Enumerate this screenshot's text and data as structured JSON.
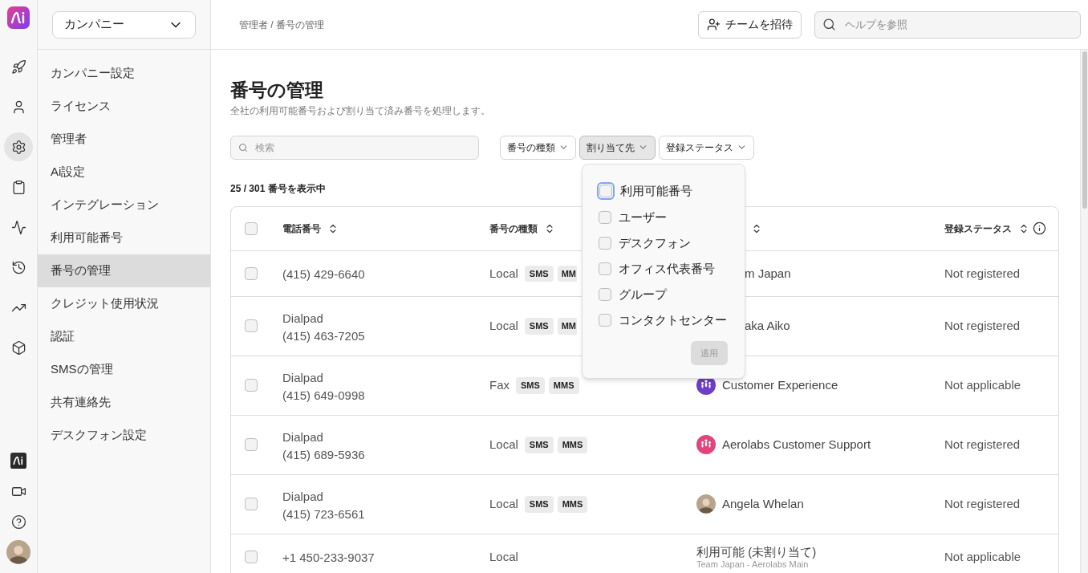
{
  "rail": {
    "top": [
      {
        "selected": false
      },
      {
        "selected": false
      },
      {
        "selected": true
      },
      {
        "selected": false
      },
      {
        "selected": false
      },
      {
        "selected": false
      },
      {
        "selected": false
      },
      {
        "selected": false
      }
    ],
    "bottom": [
      {
        "selected": false
      },
      {
        "selected": false
      },
      {
        "selected": false
      },
      {
        "selected": false
      }
    ]
  },
  "sidebar": {
    "workspace": "カンパニー",
    "items": [
      {
        "label": "カンパニー設定",
        "selected": false
      },
      {
        "label": "ライセンス",
        "selected": false
      },
      {
        "label": "管理者",
        "selected": false
      },
      {
        "label": "Ai設定",
        "selected": false
      },
      {
        "label": "インテグレーション",
        "selected": false
      },
      {
        "label": "利用可能番号",
        "selected": false
      },
      {
        "label": "番号の管理",
        "selected": true
      },
      {
        "label": "クレジット使用状況",
        "selected": false
      },
      {
        "label": "認証",
        "selected": false
      },
      {
        "label": "SMSの管理",
        "selected": false
      },
      {
        "label": "共有連絡先",
        "selected": false
      },
      {
        "label": "デスクフォン設定",
        "selected": false
      }
    ]
  },
  "topbar": {
    "breadcrumb": "管理者 / 番号の管理",
    "invite_button": "チームを招待",
    "help_search": {
      "placeholder": "ヘルプを参照"
    }
  },
  "page": {
    "title": "番号の管理",
    "subtitle": "全社の利用可能番号および割り当て済み番号を処理します。",
    "search": {
      "placeholder": "検索"
    },
    "filters": [
      {
        "label": "番号の種類",
        "open": false
      },
      {
        "label": "割り当て先",
        "open": true
      },
      {
        "label": "登録ステータス",
        "open": false
      }
    ],
    "dropdown": {
      "options": [
        {
          "label": "利用可能番号",
          "checked": false,
          "focused": true
        },
        {
          "label": "ユーザー",
          "checked": false,
          "focused": false
        },
        {
          "label": "デスクフォン",
          "checked": false,
          "focused": false
        },
        {
          "label": "オフィス代表番号",
          "checked": false,
          "focused": false
        },
        {
          "label": "グループ",
          "checked": false,
          "focused": false
        },
        {
          "label": "コンタクトセンター",
          "checked": false,
          "focused": false
        }
      ],
      "apply": {
        "label": "適用",
        "disabled": true
      }
    },
    "count": "25 / 301 番号を表示中",
    "table": {
      "select_all": {
        "checked": false
      },
      "columns": [
        {
          "label": "電話番号",
          "info": false
        },
        {
          "label": "番号の種類",
          "info": false
        },
        {
          "info": false
        },
        {
          "label": "登録ステータス",
          "info": true
        }
      ],
      "rows": [
        {
          "checked": false,
          "number": "(415) 429-6640",
          "type": "Local",
          "tags": [
            {
              "label": "SMS",
              "kind": "full"
            },
            {
              "label": "MM",
              "kind": "clipped"
            }
          ],
          "assignee": {
            "kind": "clipped",
            "name": "m Japan"
          },
          "status": "Not registered"
        },
        {
          "checked": false,
          "provider": "Dialpad",
          "number": "(415) 463-7205",
          "type": "Local",
          "tags": [
            {
              "label": "SMS",
              "kind": "full"
            },
            {
              "label": "MM",
              "kind": "clipped"
            }
          ],
          "assignee": {
            "kind": "clipped",
            "name": "aka Aiko"
          },
          "status": "Not registered"
        },
        {
          "checked": false,
          "provider": "Dialpad",
          "number": "(415) 649-0998",
          "type": "Fax",
          "tags": [
            {
              "label": "SMS",
              "kind": "full"
            },
            {
              "label": "MMS",
              "kind": "full"
            }
          ],
          "assignee": {
            "kind": "group",
            "color": "#6d3fc8",
            "name": "Customer Experience"
          },
          "status": "Not applicable"
        },
        {
          "checked": false,
          "provider": "Dialpad",
          "number": "(415) 689-5936",
          "type": "Local",
          "tags": [
            {
              "label": "SMS",
              "kind": "full"
            },
            {
              "label": "MMS",
              "kind": "full"
            }
          ],
          "assignee": {
            "kind": "group",
            "color": "#e0457b",
            "name": "Aerolabs Customer Support"
          },
          "status": "Not registered"
        },
        {
          "checked": false,
          "provider": "Dialpad",
          "number": "(415) 723-6561",
          "type": "Local",
          "tags": [
            {
              "label": "SMS",
              "kind": "full"
            },
            {
              "label": "MMS",
              "kind": "full"
            }
          ],
          "assignee": {
            "kind": "person",
            "name": "Angela Whelan"
          },
          "status": "Not registered"
        },
        {
          "checked": false,
          "number": "+1 450-233-9037",
          "type": "Local",
          "assignee": {
            "kind": "available",
            "name": "利用可能 (未割り当て)",
            "detail": "Team Japan - Aerolabs Main"
          },
          "status": "Not applicable"
        }
      ]
    }
  }
}
